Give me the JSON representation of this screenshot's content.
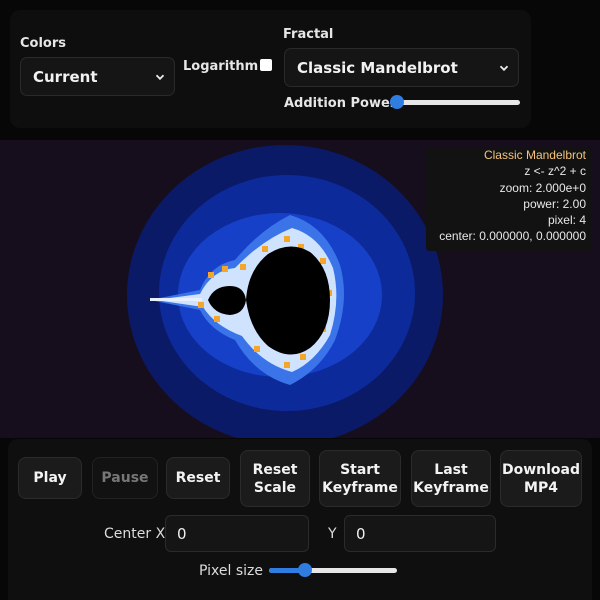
{
  "controls": {
    "colors_label": "Colors",
    "colors_value": "Current",
    "logarithm_label": "Logarithm",
    "logarithm_checked": false,
    "fractal_label": "Fractal",
    "fractal_value": "Classic Mandelbrot",
    "addition_power_label": "Addition Power",
    "addition_power_level": 0.0
  },
  "info": {
    "title": "Classic Mandelbrot",
    "formula": "z <- z^2 + c",
    "zoom": "zoom: 2.000e+0",
    "power": "power: 2.00",
    "pixel": "pixel: 4",
    "center": "center: 0.000000, 0.000000"
  },
  "buttons": {
    "play": "Play",
    "pause": "Pause",
    "reset": "Reset",
    "reset_scale": "Reset\nScale",
    "start_keyframe": "Start\nKeyframe",
    "last_keyframe": "Last\nKeyframe",
    "download_mp4": "Download\nMP4"
  },
  "fields": {
    "center_x_label": "Center X",
    "center_x_value": "0",
    "y_label": "Y",
    "y_value": "0",
    "pixel_size_label": "Pixel size",
    "pixel_size_level": 0.25
  },
  "colors": {
    "accent": "#2f7de1",
    "info_title": "#f5c47c",
    "canvas_bg": "#170e1d"
  }
}
